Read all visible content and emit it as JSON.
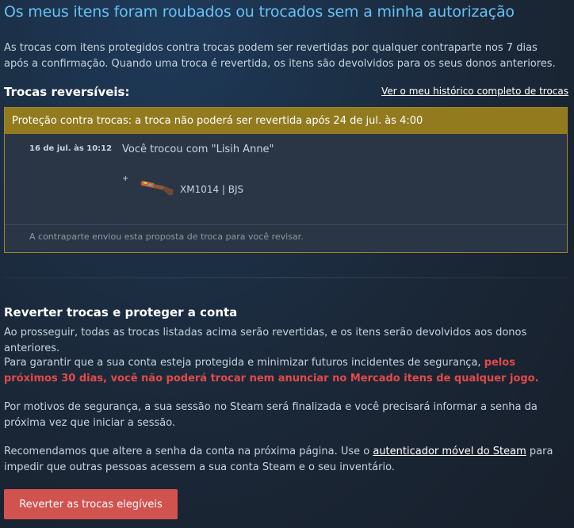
{
  "page": {
    "title": "Os meus itens foram roubados ou trocados sem a minha autorização",
    "intro": "As trocas com itens protegidos contra trocas podem ser revertidas por qualquer contraparte nos 7 dias após a confirmação. Quando uma troca é revertida, os itens são devolvidos para os seus donos anteriores."
  },
  "reversible": {
    "heading": "Trocas reversíveis:",
    "history_link": "Ver o meu histórico completo de trocas"
  },
  "trade": {
    "banner": "Proteção contra trocas: a troca não poderá ser revertida após 24 de jul. às 4:00",
    "date": "16 de jul. às 10:12",
    "description": "Você trocou com \"Lisih Anne\"",
    "plus": "+",
    "item_name": "XM1014 | BJS",
    "item_icon": "shotgun-icon",
    "footer": "A contraparte enviou esta proposta de troca para você revisar."
  },
  "revert": {
    "heading": "Reverter trocas e proteger a conta",
    "p1": "Ao prosseguir, todas as trocas listadas acima serão revertidas, e os itens serão devolvidos aos donos anteriores.",
    "p2_before": "Para garantir que a sua conta esteja protegida e minimizar futuros incidentes de segurança, ",
    "p2_warning": "pelos próximos 30 dias, você não poderá trocar nem anunciar no Mercado itens de qualquer jogo.",
    "p3": "Por motivos de segurança, a sua sessão no Steam será finalizada e você precisará informar a senha da próxima vez que iniciar a sessão.",
    "p4_before": "Recomendamos que altere a senha da conta na próxima página. Use o ",
    "p4_link": "autenticador móvel do Steam",
    "p4_after": " para impedir que outras pessoas acessem a sua conta Steam e o seu inventário.",
    "button": "Reverter as trocas elegíveis"
  },
  "colors": {
    "title": "#67c1f5",
    "banner": "#927b1f",
    "warning": "#e24a4a",
    "button": "#d1534f"
  }
}
